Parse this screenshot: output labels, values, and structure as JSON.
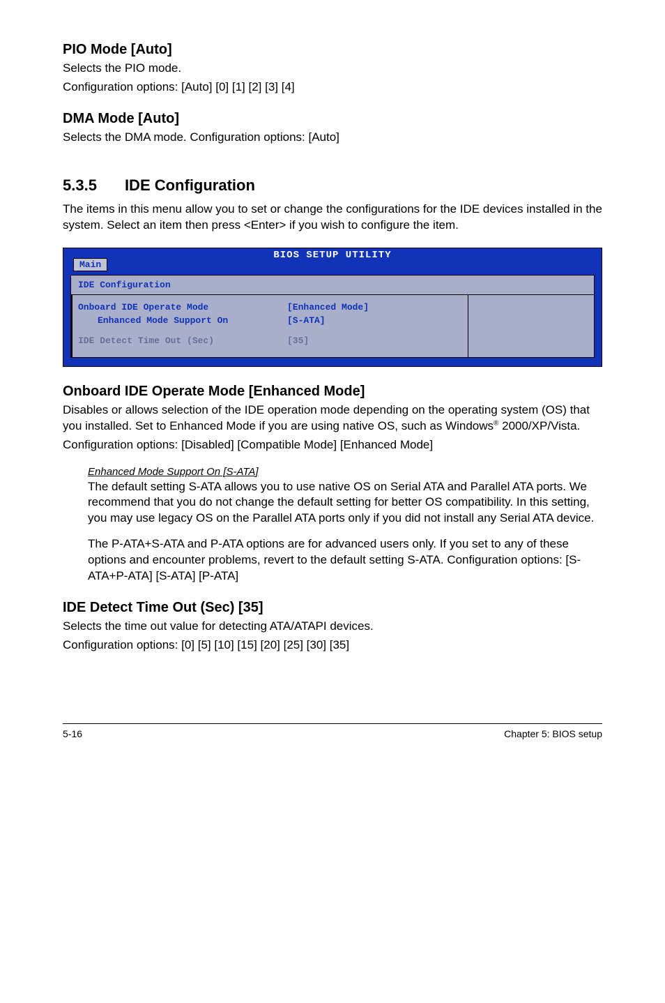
{
  "pio": {
    "heading": "PIO Mode [Auto]",
    "line1": "Selects the PIO mode.",
    "line2": "Configuration options: [Auto] [0] [1] [2] [3] [4]"
  },
  "dma": {
    "heading": "DMA Mode [Auto]",
    "line1": "Selects the DMA mode. Configuration options: [Auto]"
  },
  "section535": {
    "num": "5.3.5",
    "title": "IDE Configuration",
    "para": "The items in this menu allow you to set or change the configurations for the IDE devices installed in the system. Select an item then press <Enter> if you wish to configure the item."
  },
  "bios": {
    "header": "BIOS SETUP UTILITY",
    "tab": "Main",
    "innerTitle": "IDE Configuration",
    "row1": {
      "label": "Onboard IDE Operate Mode",
      "value": "[Enhanced Mode]"
    },
    "row2": {
      "label": "Enhanced Mode Support On",
      "value": "[S-ATA]"
    },
    "row3": {
      "label": "IDE Detect Time Out (Sec)",
      "value": "[35]"
    }
  },
  "onboard": {
    "heading": "Onboard IDE Operate Mode [Enhanced Mode]",
    "para1a": "Disables or allows selection of the IDE operation mode depending on the operating system (OS) that you installed. Set to Enhanced Mode if you are using native OS, such as Windows",
    "para1b": " 2000/XP/Vista.",
    "para2": "Configuration options: [Disabled] [Compatible Mode] [Enhanced Mode]"
  },
  "enhanced": {
    "title": "Enhanced Mode Support On [S-ATA]",
    "para1": "The default setting S-ATA allows you to use native OS on Serial ATA and Parallel ATA ports. We recommend that you do not change the default setting for better OS compatibility. In this setting, you may use legacy OS on the Parallel ATA ports only if you did not install any Serial ATA device.",
    "para2": "The P-ATA+S-ATA and P-ATA options are for advanced users only. If you set to any of these options and encounter problems, revert to the default setting S-ATA. Configuration options: [S-ATA+P-ATA] [S-ATA] [P-ATA]"
  },
  "idetimeout": {
    "heading": "IDE Detect Time Out (Sec) [35]",
    "line1": "Selects the time out value for detecting ATA/ATAPI devices.",
    "line2": "Configuration options: [0] [5] [10] [15] [20] [25] [30] [35]"
  },
  "footer": {
    "left": "5-16",
    "right": "Chapter 5: BIOS setup"
  },
  "reg": "®"
}
